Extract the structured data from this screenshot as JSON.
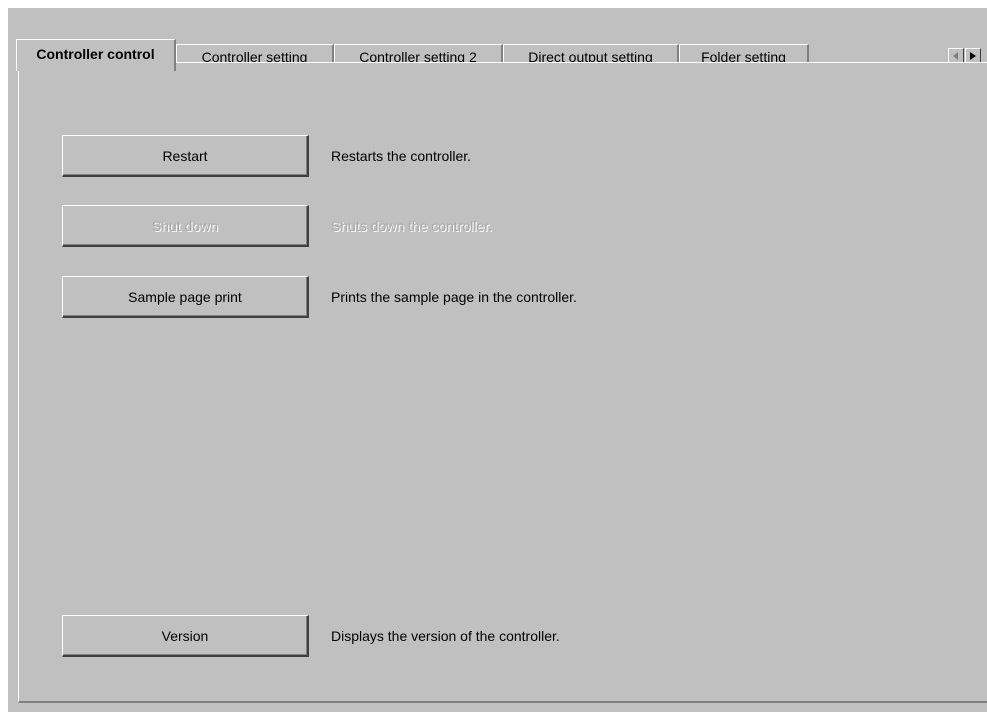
{
  "tabs": [
    {
      "label": "Controller control",
      "active": true
    },
    {
      "label": "Controller setting",
      "active": false
    },
    {
      "label": "Controller setting 2",
      "active": false
    },
    {
      "label": "Direct output setting",
      "active": false
    },
    {
      "label": "Folder setting",
      "active": false
    }
  ],
  "tab_scroll": {
    "left_icon": "scroll-left-icon",
    "right_icon": "scroll-right-icon"
  },
  "actions": {
    "restart": {
      "label": "Restart",
      "description": "Restarts the controller.",
      "enabled": true
    },
    "shutdown": {
      "label": "Shut down",
      "description": "Shuts down the controller.",
      "enabled": false
    },
    "sample_print": {
      "label": "Sample page print",
      "description": "Prints the sample page in the controller.",
      "enabled": true
    },
    "version": {
      "label": "Version",
      "description": "Displays the version of the controller.",
      "enabled": true
    }
  },
  "colors": {
    "face": "#c0c0c0",
    "disabled_text": "#a8a8a8"
  }
}
